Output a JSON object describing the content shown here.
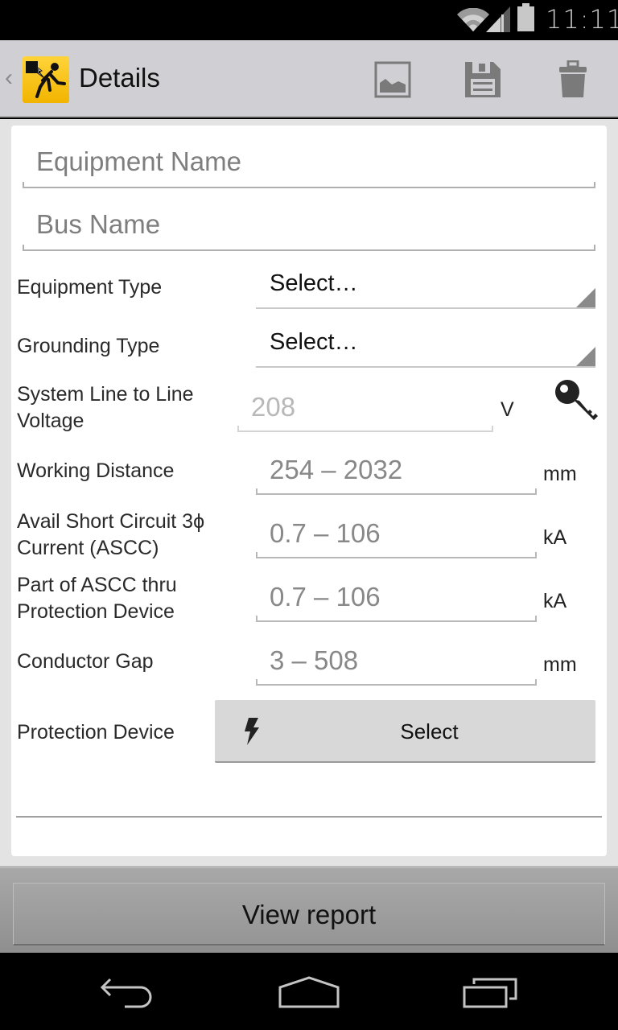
{
  "status_bar": {
    "time": "11:11",
    "icons": [
      "wifi-icon",
      "cell-signal-icon",
      "battery-icon"
    ]
  },
  "action_bar": {
    "up_caret": "‹",
    "app_icon": "electrical-hazard-app-icon",
    "title": "Details",
    "actions": [
      {
        "name": "image-icon",
        "label": "Image"
      },
      {
        "name": "save-icon",
        "label": "Save"
      },
      {
        "name": "delete-icon",
        "label": "Delete"
      }
    ]
  },
  "form": {
    "equipment_name": {
      "placeholder": "Equipment Name",
      "value": ""
    },
    "bus_name": {
      "placeholder": "Bus Name",
      "value": ""
    },
    "equipment_type": {
      "label": "Equipment Type",
      "selected": "Select…"
    },
    "grounding_type": {
      "label": "Grounding Type",
      "selected": "Select…"
    },
    "voltage": {
      "label_line1": "System Line to Line",
      "label_line2": "Voltage",
      "placeholder": "208",
      "unit": "V",
      "key_icon": "key-icon"
    },
    "working_distance": {
      "label": "Working Distance",
      "placeholder": "254 – 2032",
      "unit": "mm"
    },
    "ascc": {
      "label_line1": "Avail Short Circuit 3ϕ",
      "label_line2": "Current (ASCC)",
      "placeholder": "0.7 – 106",
      "unit": "kA"
    },
    "ascc_thru_device": {
      "label_line1": "Part of ASCC thru",
      "label_line2": "Protection Device",
      "placeholder": "0.7 – 106",
      "unit": "kA"
    },
    "conductor_gap": {
      "label": "Conductor Gap",
      "placeholder": "3 – 508",
      "unit": "mm"
    },
    "protection_device": {
      "label": "Protection Device",
      "button_label": "Select",
      "button_icon": "lightning-bolt-icon"
    }
  },
  "footer": {
    "view_report_label": "View report"
  },
  "nav_bar": {
    "buttons": [
      "back-icon",
      "home-icon",
      "recent-apps-icon"
    ]
  },
  "colors": {
    "action_bar_bg": "#d0d0d4",
    "app_icon_yellow": "#f7c21a",
    "placeholder_gray": "#7e7e7e",
    "card_bg": "#ffffff"
  }
}
